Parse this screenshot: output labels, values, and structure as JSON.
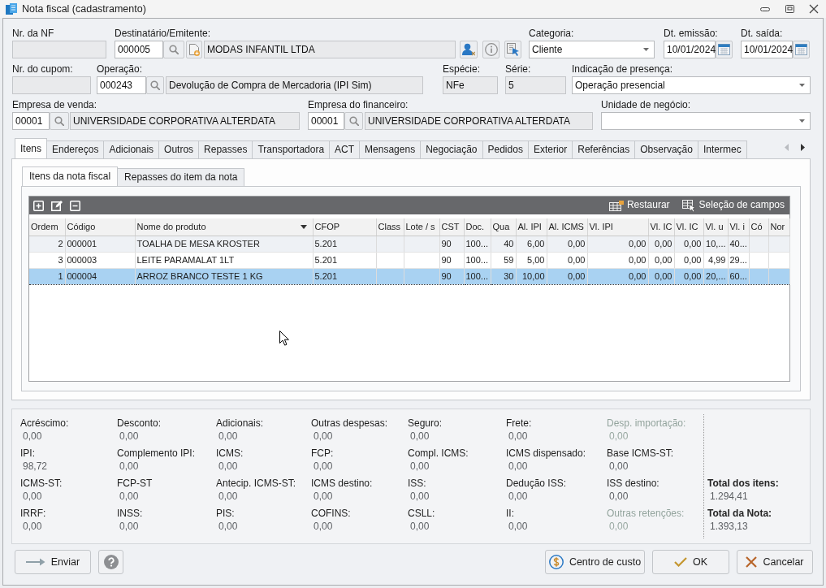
{
  "window": {
    "title": "Nota fiscal (cadastramento)"
  },
  "form": {
    "nf_number": {
      "label": "Nr. da NF"
    },
    "recipient": {
      "label": "Destinatário/Emitente:",
      "code": "000005",
      "name": "MODAS INFANTIL LTDA"
    },
    "category": {
      "label": "Categoria:",
      "value": "Cliente"
    },
    "issue_date": {
      "label": "Dt. emissão:",
      "value": "10/01/2024"
    },
    "exit_date": {
      "label": "Dt. saída:",
      "value": "10/01/2024"
    },
    "coupon_number": {
      "label": "Nr. do cupom:"
    },
    "operation": {
      "label": "Operação:",
      "code": "000243",
      "name": "Devolução de Compra de Mercadoria (IPI Sim)"
    },
    "species": {
      "label": "Espécie:",
      "value": "NFe"
    },
    "series": {
      "label": "Série:",
      "value": "5"
    },
    "presence": {
      "label": "Indicação de presença:",
      "value": "Operação presencial"
    },
    "sales_company": {
      "label": "Empresa de venda:",
      "code": "00001",
      "name": "UNIVERSIDADE CORPORATIVA ALTERDATA"
    },
    "finance_company": {
      "label": "Empresa do financeiro:",
      "code": "00001",
      "name": "UNIVERSIDADE CORPORATIVA ALTERDATA"
    },
    "business_unit": {
      "label": "Unidade de negócio:"
    }
  },
  "tabs": [
    {
      "label": "Itens",
      "selected": true
    },
    {
      "label": "Endereços",
      "selected": false
    },
    {
      "label": "Adicionais",
      "selected": false
    },
    {
      "label": "Outros",
      "selected": false
    },
    {
      "label": "Repasses",
      "selected": false
    },
    {
      "label": "Transportadora",
      "selected": false
    },
    {
      "label": "ACT",
      "selected": false
    },
    {
      "label": "Mensagens",
      "selected": false
    },
    {
      "label": "Negociação",
      "selected": false
    },
    {
      "label": "Pedidos",
      "selected": false
    },
    {
      "label": "Exterior",
      "selected": false
    },
    {
      "label": "Referências",
      "selected": false
    },
    {
      "label": "Observação",
      "selected": false
    },
    {
      "label": "Intermec",
      "selected": false
    }
  ],
  "subtabs": [
    {
      "label": "Itens da nota fiscal",
      "selected": true
    },
    {
      "label": "Repasses do item da nota",
      "selected": false
    }
  ],
  "grid": {
    "toolbar": [
      {
        "kind": "restore",
        "label": "Restaurar"
      },
      {
        "kind": "field_selection",
        "label": "Seleção de campos"
      }
    ],
    "columns": [
      {
        "label": "Ordem",
        "sorted": false
      },
      {
        "label": "Código",
        "sorted": false
      },
      {
        "label": "Nome do produto",
        "sorted": true
      },
      {
        "label": "CFOP",
        "sorted": false
      },
      {
        "label": "Class",
        "sorted": false
      },
      {
        "label": "Lote / s",
        "sorted": false
      },
      {
        "label": "CST",
        "sorted": false
      },
      {
        "label": "Doc.",
        "sorted": false
      },
      {
        "label": "Qua",
        "sorted": false
      },
      {
        "label": "Al. IPI",
        "sorted": false
      },
      {
        "label": "Al. ICMS",
        "sorted": false
      },
      {
        "label": "Vl. IPI",
        "sorted": false
      },
      {
        "label": "Vl. IC",
        "sorted": false
      },
      {
        "label": "Vl. IC",
        "sorted": false
      },
      {
        "label": "Vl. u",
        "sorted": false
      },
      {
        "label": "Vl. i",
        "sorted": false
      },
      {
        "label": "Có",
        "sorted": false
      },
      {
        "label": "Nor",
        "sorted": false
      }
    ],
    "rows": [
      {
        "selected": false,
        "cells": [
          "2",
          "000001",
          "TOALHA DE MESA KROSTER",
          "5.201",
          null,
          null,
          "90",
          "100...",
          "40",
          "6,00",
          "0,00",
          "0,00",
          "0,00",
          "0,00",
          "10,...",
          "40...",
          null,
          null
        ]
      },
      {
        "selected": false,
        "cells": [
          "3",
          "000003",
          "LEITE PARAMALAT 1LT",
          "5.201",
          null,
          null,
          "90",
          "100...",
          "59",
          "5,00",
          "0,00",
          "0,00",
          "0,00",
          "0,00",
          "4,99",
          "29...",
          null,
          null
        ]
      },
      {
        "selected": true,
        "cells": [
          "1",
          "000004",
          "ARROZ BRANCO TESTE 1 KG",
          "5.201",
          null,
          null,
          "90",
          "100...",
          "30",
          "10,00",
          "0,00",
          "0,00",
          "0,00",
          "0,00",
          "20,...",
          "60...",
          null,
          null
        ]
      }
    ]
  },
  "totals": {
    "items": [
      {
        "label": "Acréscimo:",
        "value": "0,00",
        "disabled": false
      },
      {
        "label": "Desconto:",
        "value": "0,00",
        "disabled": false
      },
      {
        "label": "Adicionais:",
        "value": "0,00",
        "disabled": false
      },
      {
        "label": "Outras despesas:",
        "value": "0,00",
        "disabled": false
      },
      {
        "label": "Seguro:",
        "value": "0,00",
        "disabled": false
      },
      {
        "label": "Frete:",
        "value": "0,00",
        "disabled": false
      },
      {
        "label": "Desp. importação:",
        "value": "0,00",
        "disabled": true
      },
      {
        "label": "IPI:",
        "value": "98,72",
        "disabled": false
      },
      {
        "label": "Complemento IPI:",
        "value": "0,00",
        "disabled": false
      },
      {
        "label": "ICMS:",
        "value": "0,00",
        "disabled": false
      },
      {
        "label": "FCP:",
        "value": "0,00",
        "disabled": false
      },
      {
        "label": "Compl. ICMS:",
        "value": "0,00",
        "disabled": false
      },
      {
        "label": "ICMS dispensado:",
        "value": "0,00",
        "disabled": false
      },
      {
        "label": "Base ICMS-ST:",
        "value": "0,00",
        "disabled": false
      },
      {
        "label": "ICMS-ST:",
        "value": "0,00",
        "disabled": false
      },
      {
        "label": "FCP-ST",
        "value": "0,00",
        "disabled": false
      },
      {
        "label": "Antecip. ICMS-ST:",
        "value": "0,00",
        "disabled": false
      },
      {
        "label": "ICMS destino:",
        "value": "0,00",
        "disabled": false
      },
      {
        "label": "ISS:",
        "value": "0,00",
        "disabled": false
      },
      {
        "label": "Dedução ISS:",
        "value": "0,00",
        "disabled": false
      },
      {
        "label": "ISS destino:",
        "value": "0,00",
        "disabled": false
      },
      {
        "label": "IRRF:",
        "value": "0,00",
        "disabled": false
      },
      {
        "label": "INSS:",
        "value": "0,00",
        "disabled": false
      },
      {
        "label": "PIS:",
        "value": "0,00",
        "disabled": false
      },
      {
        "label": "COFINS:",
        "value": "0,00",
        "disabled": false
      },
      {
        "label": "CSLL:",
        "value": "0,00",
        "disabled": false
      },
      {
        "label": "II:",
        "value": "0,00",
        "disabled": false
      },
      {
        "label": "Outras retenções:",
        "value": "0,00",
        "disabled": true
      }
    ],
    "summary": [
      {
        "label": "Total dos itens:",
        "value": "1.294,41"
      },
      {
        "label": "Total da Nota:",
        "value": "1.393,13"
      }
    ]
  },
  "buttons": [
    {
      "kind": "send",
      "label": "Enviar"
    },
    {
      "kind": "help"
    },
    {
      "kind": "cost_center",
      "label": "Centro de custo"
    },
    {
      "kind": "ok",
      "label": "OK"
    },
    {
      "kind": "cancel",
      "label": "Cancelar"
    }
  ]
}
